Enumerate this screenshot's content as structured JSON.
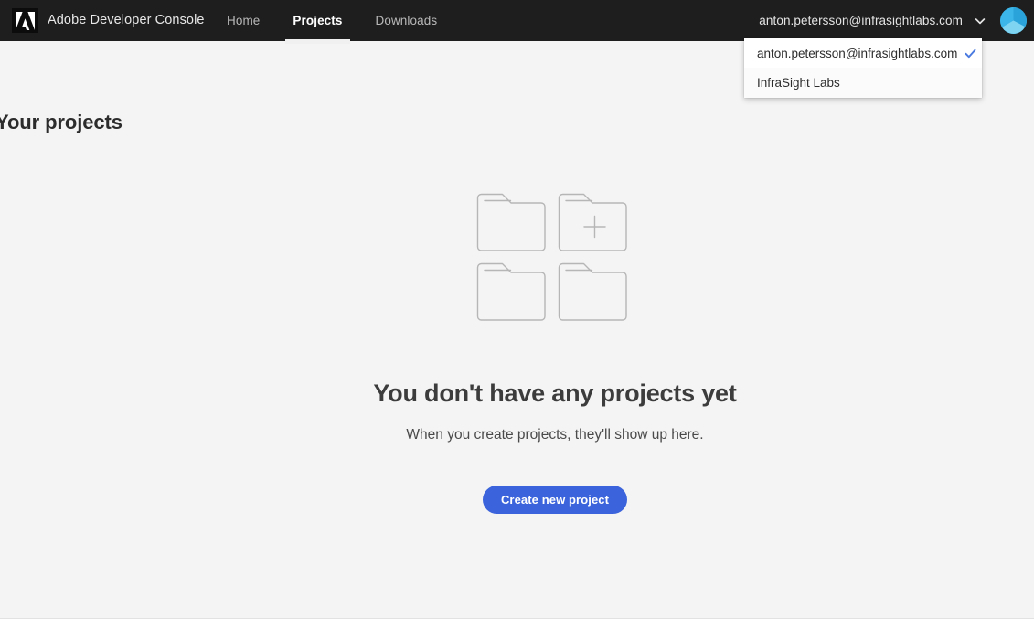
{
  "header": {
    "logo_icon": "adobe-logo-icon",
    "brand_title": "Adobe Developer Console",
    "nav": [
      {
        "label": "Home",
        "active": false
      },
      {
        "label": "Projects",
        "active": true
      },
      {
        "label": "Downloads",
        "active": false
      }
    ],
    "account": {
      "email": "anton.petersson@infrasightlabs.com",
      "chevron_icon": "chevron-down-icon",
      "avatar_icon": "user-avatar-icon"
    }
  },
  "dropdown": {
    "visible": true,
    "items": [
      {
        "label": "anton.petersson@infrasightlabs.com",
        "selected": true,
        "check_icon": "check-icon"
      },
      {
        "label": "InfraSight Labs",
        "selected": false
      }
    ]
  },
  "main": {
    "page_title": "Your projects",
    "illustration_icon": "folders-empty-illustration",
    "empty_title": "You don't have any projects yet",
    "empty_subtitle": "When you create projects, they'll show up here.",
    "create_button_label": "Create new project"
  },
  "colors": {
    "header_bg": "#1e1e1e",
    "page_bg": "#f4f4f4",
    "accent_blue": "#3b63db",
    "check_blue": "#4a7ae0",
    "avatar_blue": "#3cb6e8",
    "text_dark": "#2c2c2c",
    "nav_inactive": "#b9b9b9",
    "illustration_stroke": "#b6b6b6"
  }
}
